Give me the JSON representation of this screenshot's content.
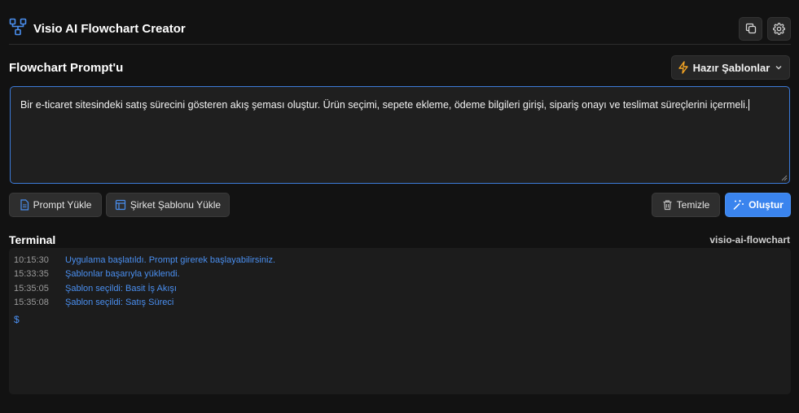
{
  "header": {
    "title": "Visio AI Flowchart Creator",
    "logo_icon": "flowchart-icon",
    "copy_icon": "copy-icon",
    "settings_icon": "gear-icon"
  },
  "prompt_section": {
    "title": "Flowchart Prompt'u",
    "templates_label": "Hazır Şablonlar",
    "prompt_text": "Bir e-ticaret sitesindeki satış sürecini gösteren akış şeması oluştur. Ürün seçimi, sepete ekleme, ödeme bilgileri girişi, sipariş onayı ve teslimat süreçlerini içermeli."
  },
  "actions": {
    "load_prompt": "Prompt Yükle",
    "load_company_template": "Şirket Şablonu Yükle",
    "clear": "Temizle",
    "create": "Oluştur"
  },
  "terminal": {
    "title": "Terminal",
    "name": "visio-ai-flowchart",
    "logs": [
      {
        "time": "10:15:30",
        "message": "Uygulama başlatıldı. Prompt girerek başlayabilirsiniz."
      },
      {
        "time": "15:33:35",
        "message": "Şablonlar başarıyla yüklendi."
      },
      {
        "time": "15:35:05",
        "message": "Şablon seçildi: Basit İş Akışı"
      },
      {
        "time": "15:35:08",
        "message": "Şablon seçildi: Satış Süreci"
      }
    ],
    "prompt_symbol": "$"
  },
  "colors": {
    "accent": "#3a84ee",
    "background": "#121212",
    "panel": "#1f1f1f"
  }
}
